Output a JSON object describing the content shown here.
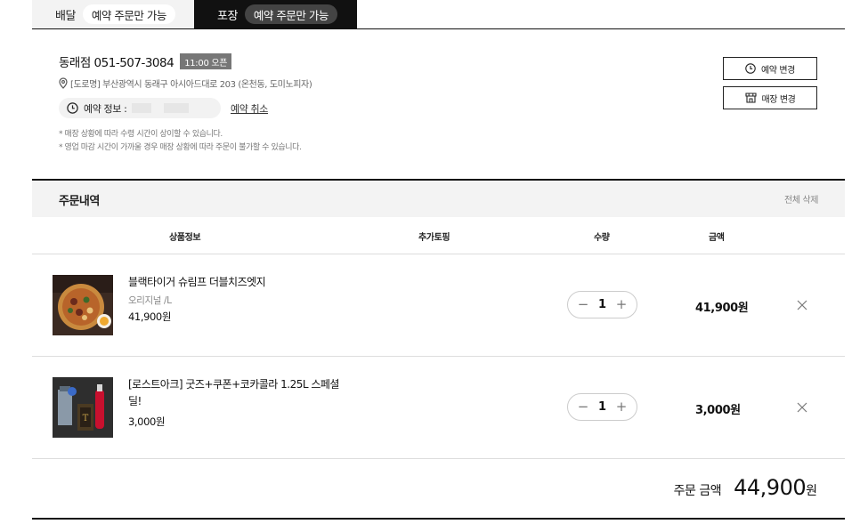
{
  "tabs": [
    {
      "label": "배달",
      "pill": "예약 주문만 가능"
    },
    {
      "label": "포장",
      "pill": "예약 주문만 가능"
    }
  ],
  "store": {
    "name": "동래점 051-507-3084",
    "badge": "11:00 오픈",
    "address": "[도로명] 부산광역시 동래구 아시아드대로 203 (온천동, 도미노피자)",
    "reservation_label": "예약 정보 : ",
    "reservation_cancel": "예약 취소",
    "notes": [
      "* 매장 상황에 따라 수령 시간이 상이할 수 있습니다.",
      "* 영업 마감 시간이 가까울 경우 매장 상황에 따라 주문이 불가할 수 있습니다."
    ],
    "change_reservation": "예약 변경",
    "change_store": "매장 변경"
  },
  "order": {
    "title": "주문내역",
    "delete_all": "전체 삭제",
    "columns": {
      "product": "상품정보",
      "topping": "추가토핑",
      "qty": "수량",
      "amount": "금액"
    },
    "items": [
      {
        "name": "블랙타이거 슈림프 더블치즈엣지",
        "option": "오리지널 /L",
        "price": "41,900원",
        "qty": "1",
        "amount": "41,900원"
      },
      {
        "name": "[로스트아크] 굿즈+쿠폰+코카콜라 1.25L 스페셜 딜!",
        "option": "",
        "price": "3,000원",
        "qty": "1",
        "amount": "3,000원"
      }
    ],
    "total_label": "주문 금액",
    "total_value": "44,900",
    "total_unit": "원"
  },
  "colors": {
    "accent": "#111111",
    "tab_active": "#111111",
    "badge": "#777777"
  }
}
